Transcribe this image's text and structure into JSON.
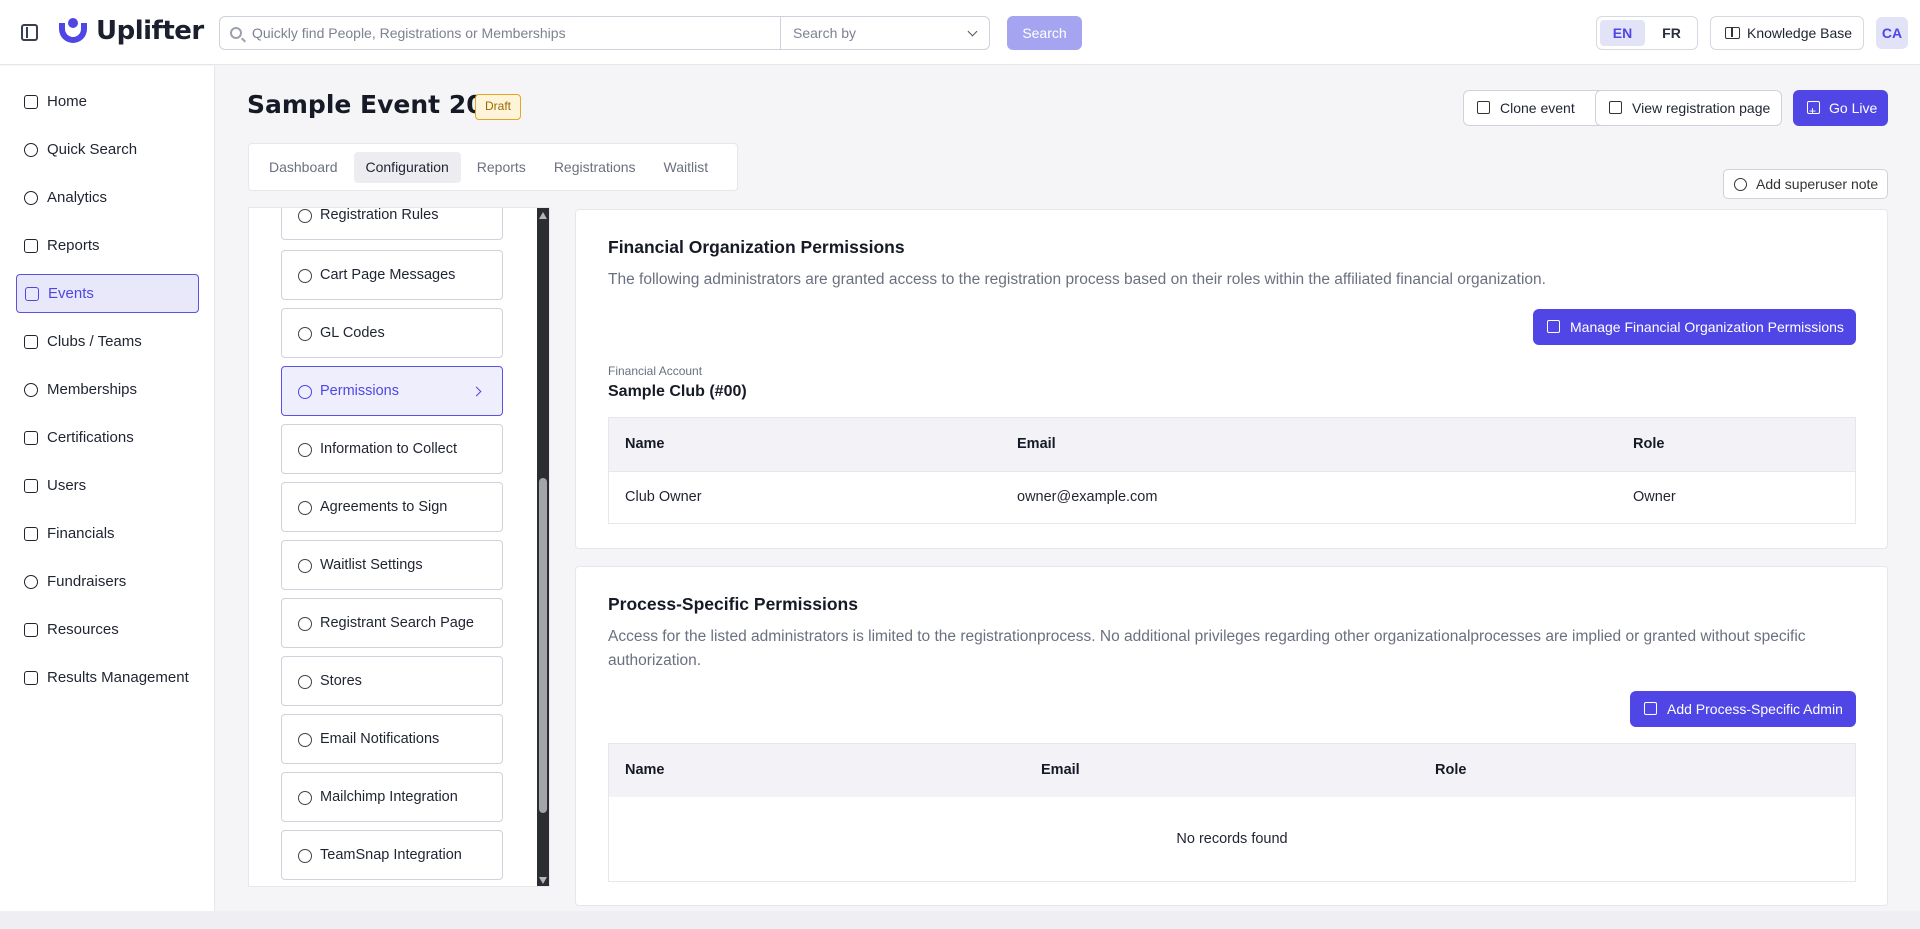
{
  "brand": {
    "name": "Uplifter",
    "accent": "#4f46e5"
  },
  "search": {
    "placeholder": "Quickly find People, Registrations or Memberships",
    "search_by_placeholder": "Search by",
    "button_label": "Search"
  },
  "language": {
    "options": [
      "EN",
      "FR"
    ],
    "selected": "EN"
  },
  "header": {
    "knowledge_base": "Knowledge Base",
    "avatar_initials": "CA"
  },
  "sidebar": {
    "items": [
      {
        "label": "Home",
        "icon": "home-icon"
      },
      {
        "label": "Quick Search",
        "icon": "search-icon"
      },
      {
        "label": "Analytics",
        "icon": "pie-chart-icon"
      },
      {
        "label": "Reports",
        "icon": "document-icon"
      },
      {
        "label": "Events",
        "icon": "calendar-icon",
        "active": true
      },
      {
        "label": "Clubs / Teams",
        "icon": "building-icon"
      },
      {
        "label": "Memberships",
        "icon": "users-icon"
      },
      {
        "label": "Certifications",
        "icon": "graduation-cap-icon"
      },
      {
        "label": "Users",
        "icon": "user-badge-icon"
      },
      {
        "label": "Financials",
        "icon": "chart-icon"
      },
      {
        "label": "Fundraisers",
        "icon": "hand-coin-icon"
      },
      {
        "label": "Resources",
        "icon": "book-icon"
      },
      {
        "label": "Results Management",
        "icon": "bar-chart-icon"
      }
    ]
  },
  "event": {
    "title": "Sample Event 2026",
    "status_badge": "Draft"
  },
  "actions": {
    "clone": "Clone event",
    "view_registration": "View registration page",
    "go_live": "Go Live",
    "add_superuser_note": "Add superuser note"
  },
  "tabs": [
    {
      "label": "Dashboard"
    },
    {
      "label": "Configuration",
      "active": true
    },
    {
      "label": "Reports"
    },
    {
      "label": "Registrations"
    },
    {
      "label": "Waitlist"
    }
  ],
  "config_items": [
    {
      "label": "Registration Rules"
    },
    {
      "label": "Cart Page Messages"
    },
    {
      "label": "GL Codes"
    },
    {
      "label": "Permissions",
      "active": true
    },
    {
      "label": "Information to Collect"
    },
    {
      "label": "Agreements to Sign"
    },
    {
      "label": "Waitlist Settings"
    },
    {
      "label": "Registrant Search Page"
    },
    {
      "label": "Stores"
    },
    {
      "label": "Email Notifications"
    },
    {
      "label": "Mailchimp Integration"
    },
    {
      "label": "TeamSnap Integration"
    }
  ],
  "financial_permissions": {
    "title": "Financial Organization Permissions",
    "description": "The following administrators are granted access to the registration process based on their roles within the affiliated financial organization.",
    "manage_button": "Manage Financial Organization Permissions",
    "account_label": "Financial Account",
    "account_value": "Sample Club (#00)",
    "columns": [
      "Name",
      "Email",
      "Role"
    ],
    "rows": [
      {
        "name": "Club Owner",
        "email": "owner@example.com",
        "role": "Owner"
      }
    ]
  },
  "process_permissions": {
    "title": "Process-Specific Permissions",
    "description": "Access for the listed administrators is limited to the registrationprocess. No additional privileges regarding other organizationalprocesses are implied or granted without specific authorization.",
    "add_button": "Add Process-Specific Admin",
    "columns": [
      "Name",
      "Email",
      "Role"
    ],
    "empty_text": "No records found"
  }
}
